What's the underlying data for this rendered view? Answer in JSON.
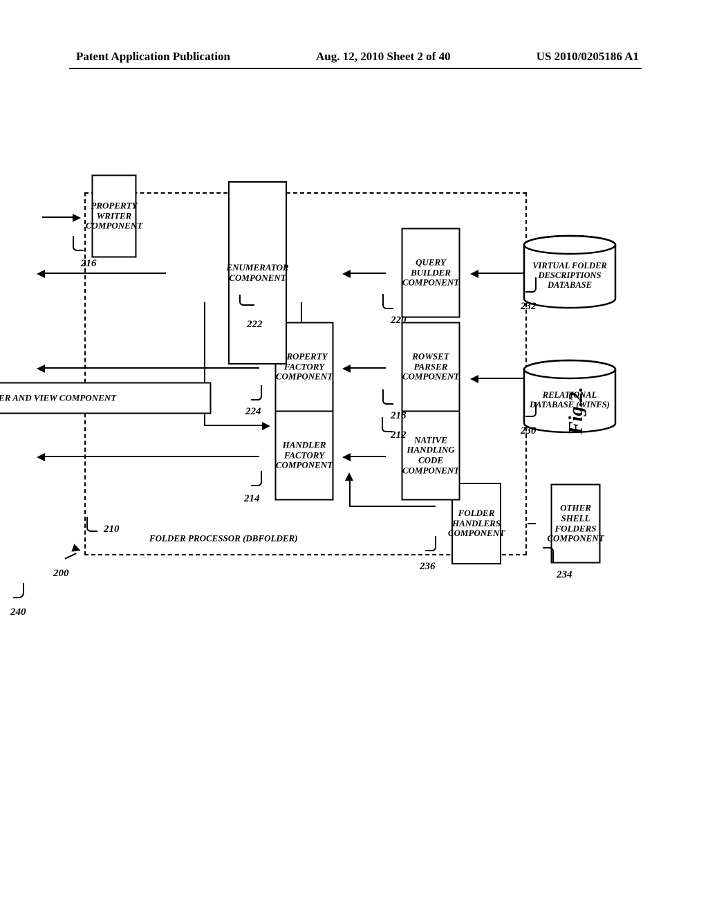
{
  "header": {
    "left": "Patent Application Publication",
    "center": "Aug. 12, 2010  Sheet 2 of 40",
    "right": "US 2010/0205186 A1"
  },
  "figure_label": "Fig.2.",
  "refs": {
    "r200": "200",
    "r210": "210",
    "r212": "212",
    "r214": "214",
    "r216": "216",
    "r218": "218",
    "r220": "220",
    "r222": "222",
    "r224": "224",
    "r230": "230",
    "r232": "232",
    "r234": "234",
    "r236": "236",
    "r240": "240"
  },
  "labels": {
    "folder_processor": "FOLDER PROCESSOR (DBFOLDER)",
    "shell_browser": "SHELL BROWSER AND VIEW COMPONENT",
    "other_shell_folders": "OTHER SHELL FOLDERS COMPONENT",
    "folder_handlers": "FOLDER HANDLERS COMPONENT",
    "native_handling": "NATIVE HANDLING CODE COMPONENT",
    "handler_factory": "HANDLER FACTORY COMPONENT",
    "rowset_parser": "ROWSET PARSER COMPONENT",
    "property_factory": "PROPERTY FACTORY COMPONENT",
    "query_builder": "QUERY BUILDER COMPONENT",
    "enumerator": "ENUMERATOR COMPONENT",
    "property_writer": "PROPERTY WRITER COMPONENT",
    "db_relational": "RELATIONAL DATABASE (WINFS)",
    "db_vfd": "VIRTUAL FOLDER DESCRIPTIONS DATABASE"
  }
}
